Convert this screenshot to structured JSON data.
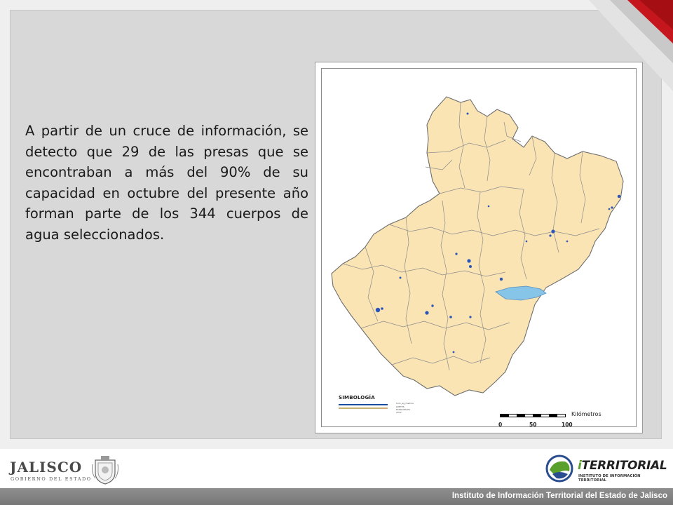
{
  "slide": {
    "body_text": "A partir de un cruce de información, se detecto que 29 de las presas que se encontraban a más del 90% de su capacidad en octubre del presente año forman parte de los 344 cuerpos de agua seleccionados."
  },
  "map": {
    "legend": {
      "title": "SIMBOLOGÍA",
      "water_label": "hum_ag_medme",
      "muni_label": "LIMITES MUNICIPALES 2012"
    },
    "scale": {
      "unit": "Kilómetros",
      "ticks": [
        "0",
        "50",
        "100"
      ]
    },
    "colors": {
      "land": "#fae4b4",
      "border": "#6e6e6e",
      "water": "#2b55b8",
      "lake": "#86c4e8"
    }
  },
  "footer": {
    "left_logo_title": "JALISCO",
    "left_logo_subtitle": "GOBIERNO DEL ESTADO",
    "right_logo_title_i": "i",
    "right_logo_title_rest": "TERRITORIAL",
    "right_logo_subtitle": "INSTITUTO DE INFORMACIÓN TERRITORIAL",
    "institute_name": "Instituto de Información Territorial del Estado de Jalisco"
  },
  "theme": {
    "accent": "#c4161c",
    "bar": "#808080"
  }
}
